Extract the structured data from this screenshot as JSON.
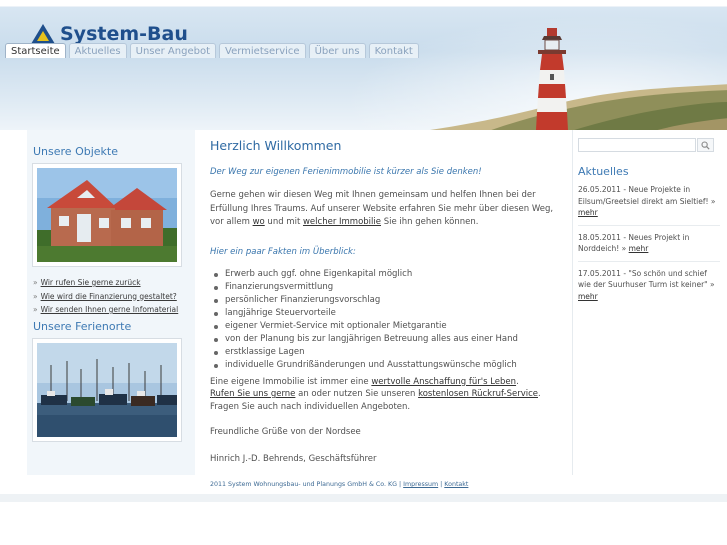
{
  "header": {
    "logo_text": "System-Bau",
    "nav": [
      {
        "label": "Startseite",
        "active": true
      },
      {
        "label": "Aktuelles",
        "active": false
      },
      {
        "label": "Unser Angebot",
        "active": false
      },
      {
        "label": "Vermietservice",
        "active": false
      },
      {
        "label": "Über uns",
        "active": false
      },
      {
        "label": "Kontakt",
        "active": false
      }
    ]
  },
  "left": {
    "objects_title": "Unsere Objekte",
    "links": [
      "Wir rufen Sie gerne zurück",
      "Wie wird die Finanzierung gestaltet?",
      "Wir senden Ihnen gerne Infomaterial"
    ],
    "places_title": "Unsere Ferienorte"
  },
  "main": {
    "title": "Herzlich Willkommen",
    "intro": "Der Weg zur eigenen Ferienimmobilie ist kürzer als Sie denken!",
    "para1_a": "Gerne gehen wir diesen Weg mit Ihnen gemeinsam und helfen Ihnen bei der Erfüllung Ihres Traums. Auf unserer Website erfahren Sie mehr über diesen Weg, vor allem ",
    "para1_link1": "wo",
    "para1_b": " und mit ",
    "para1_link2": "welcher Immobilie",
    "para1_c": " Sie ihn gehen können.",
    "facts_title": "Hier ein paar Fakten im Überblick:",
    "facts": [
      "Erwerb auch ggf. ohne Eigenkapital möglich",
      "Finanzierungsvermittlung",
      "persönlicher Finanzierungsvorschlag",
      "langjährige Steuervorteile",
      "eigener Vermiet-Service mit optionaler Mietgarantie",
      "von der Planung bis zur langjährigen Betreuung alles aus einer Hand",
      "erstklassige Lagen",
      "individuelle Grundrißänderungen und Ausstattungswünsche möglich"
    ],
    "para2_a": "Eine eigene Immobilie ist immer eine ",
    "para2_link1": "wertvolle Anschaffung für's Leben",
    "para2_b": ".",
    "para2_link2": "Rufen Sie uns gerne",
    "para2_c": " an oder nutzen Sie unseren ",
    "para2_link3": "kostenlosen Rückruf-Service",
    "para2_d": ".",
    "para2_e": "Fragen Sie auch nach individuellen Angeboten.",
    "greeting": "Freundliche Grüße von der Nordsee",
    "signature": "Hinrich J.-D. Behrends, Geschäftsführer"
  },
  "right": {
    "search_placeholder": "",
    "news_title": "Aktuelles",
    "news": [
      {
        "text": "26.05.2011 - Neue Projekte in Eilsum/Greetsiel direkt am Sieltief! » ",
        "more": "mehr"
      },
      {
        "text": "18.05.2011 - Neues Projekt in Norddeich! » ",
        "more": "mehr"
      },
      {
        "text": "17.05.2011 - \"So schön und schief wie der Suurhuser Turm ist keiner\" » ",
        "more": "mehr"
      }
    ]
  },
  "footer": {
    "copyright": "2011 System Wohnungsbau- und Planungs GmbH & Co. KG",
    "sep": " | ",
    "impressum": "Impressum",
    "kontakt": "Kontakt"
  },
  "colors": {
    "accent": "#3d79b3",
    "logo": "#1f4f8c",
    "sidebar_bg": "#f1f6fa"
  }
}
